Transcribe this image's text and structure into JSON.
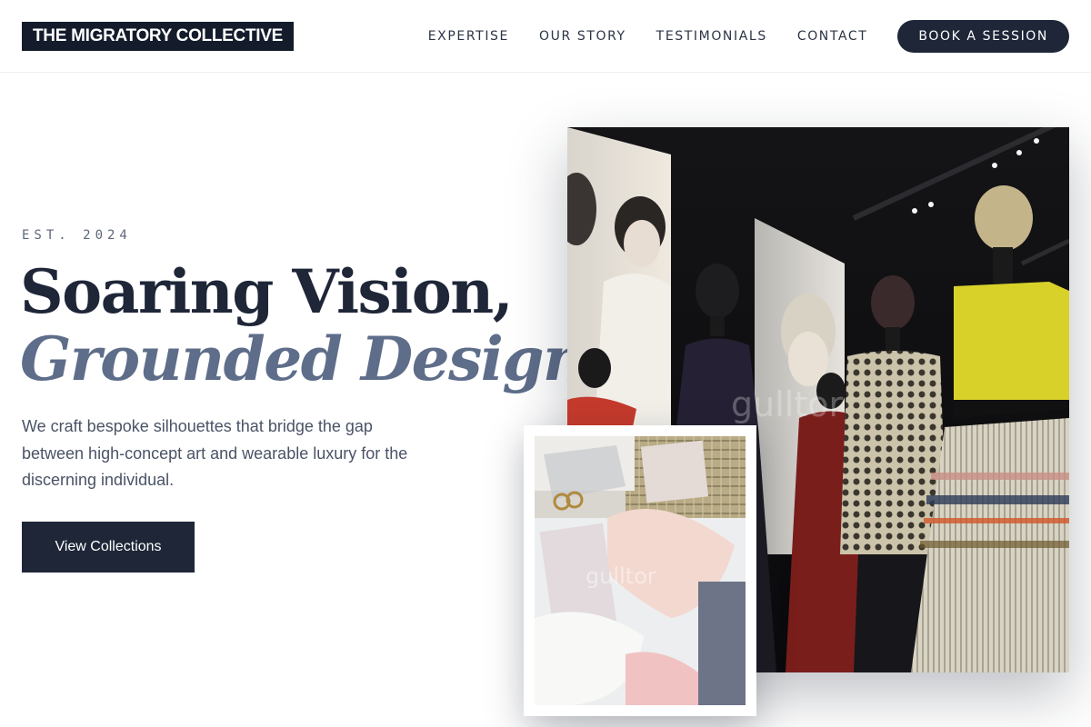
{
  "header": {
    "logo": "THE MIGRATORY COLLECTIVE",
    "nav": [
      {
        "label": "EXPERTISE"
      },
      {
        "label": "OUR STORY"
      },
      {
        "label": "TESTIMONIALS"
      },
      {
        "label": "CONTACT"
      }
    ],
    "cta_label": "BOOK A SESSION"
  },
  "hero": {
    "eyebrow": "EST. 2024",
    "headline_line1": "Soaring Vision,",
    "headline_line2": "Grounded Design.",
    "description": "We craft bespoke silhouettes that bridge the gap between high-concept art and wearable luxury for the discerning individual.",
    "button_label": "View Collections"
  },
  "images": {
    "main_watermark": "gulltor",
    "inset_watermark": "gulltor"
  },
  "colors": {
    "primary": "#1e2638",
    "accent_italic": "#5e6d89",
    "logo_bg": "#141c2c"
  }
}
